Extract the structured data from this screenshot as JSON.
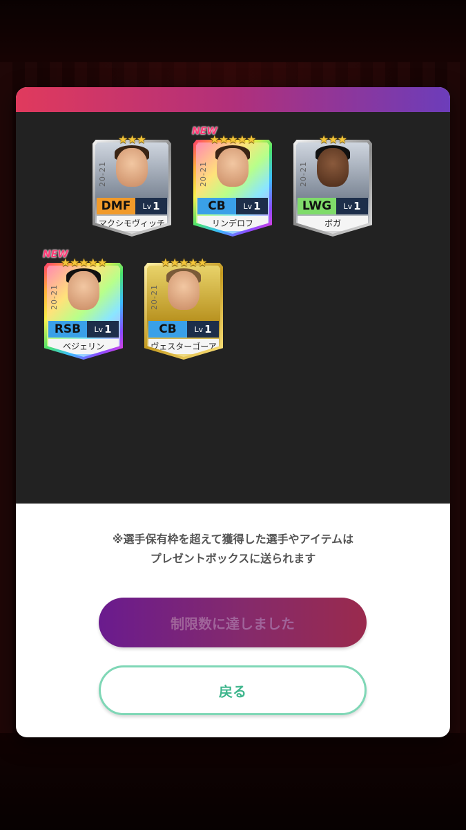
{
  "cards": [
    {
      "year": "20-21",
      "position": "DMF",
      "lv_label": "Lv",
      "lv": "1",
      "name": "マクシモヴィッチ",
      "stars": "★★★",
      "new": ""
    },
    {
      "year": "20-21",
      "position": "CB",
      "lv_label": "Lv",
      "lv": "1",
      "name": "リンデロフ",
      "stars": "★★★★★",
      "new": "NEW"
    },
    {
      "year": "20-21",
      "position": "LWG",
      "lv_label": "Lv",
      "lv": "1",
      "name": "ボガ",
      "stars": "★★★",
      "new": ""
    },
    {
      "year": "20-21",
      "position": "RSB",
      "lv_label": "Lv",
      "lv": "1",
      "name": "ベジェリン",
      "stars": "★★★★★",
      "new": "NEW"
    },
    {
      "year": "20-21",
      "position": "CB",
      "lv_label": "Lv",
      "lv": "1",
      "name": "ヴェスターゴーア",
      "stars": "★★★★★",
      "new": ""
    }
  ],
  "info_line1": "※選手保有枠を超えて獲得した選手やアイテムは",
  "info_line2": "プレゼントボックスに送られます",
  "limit_button": "制限数に達しました",
  "back_button": "戻る",
  "colors": {
    "header_start": "#e03a5d",
    "header_end": "#6c3dba",
    "back_accent": "#3fb68d"
  }
}
